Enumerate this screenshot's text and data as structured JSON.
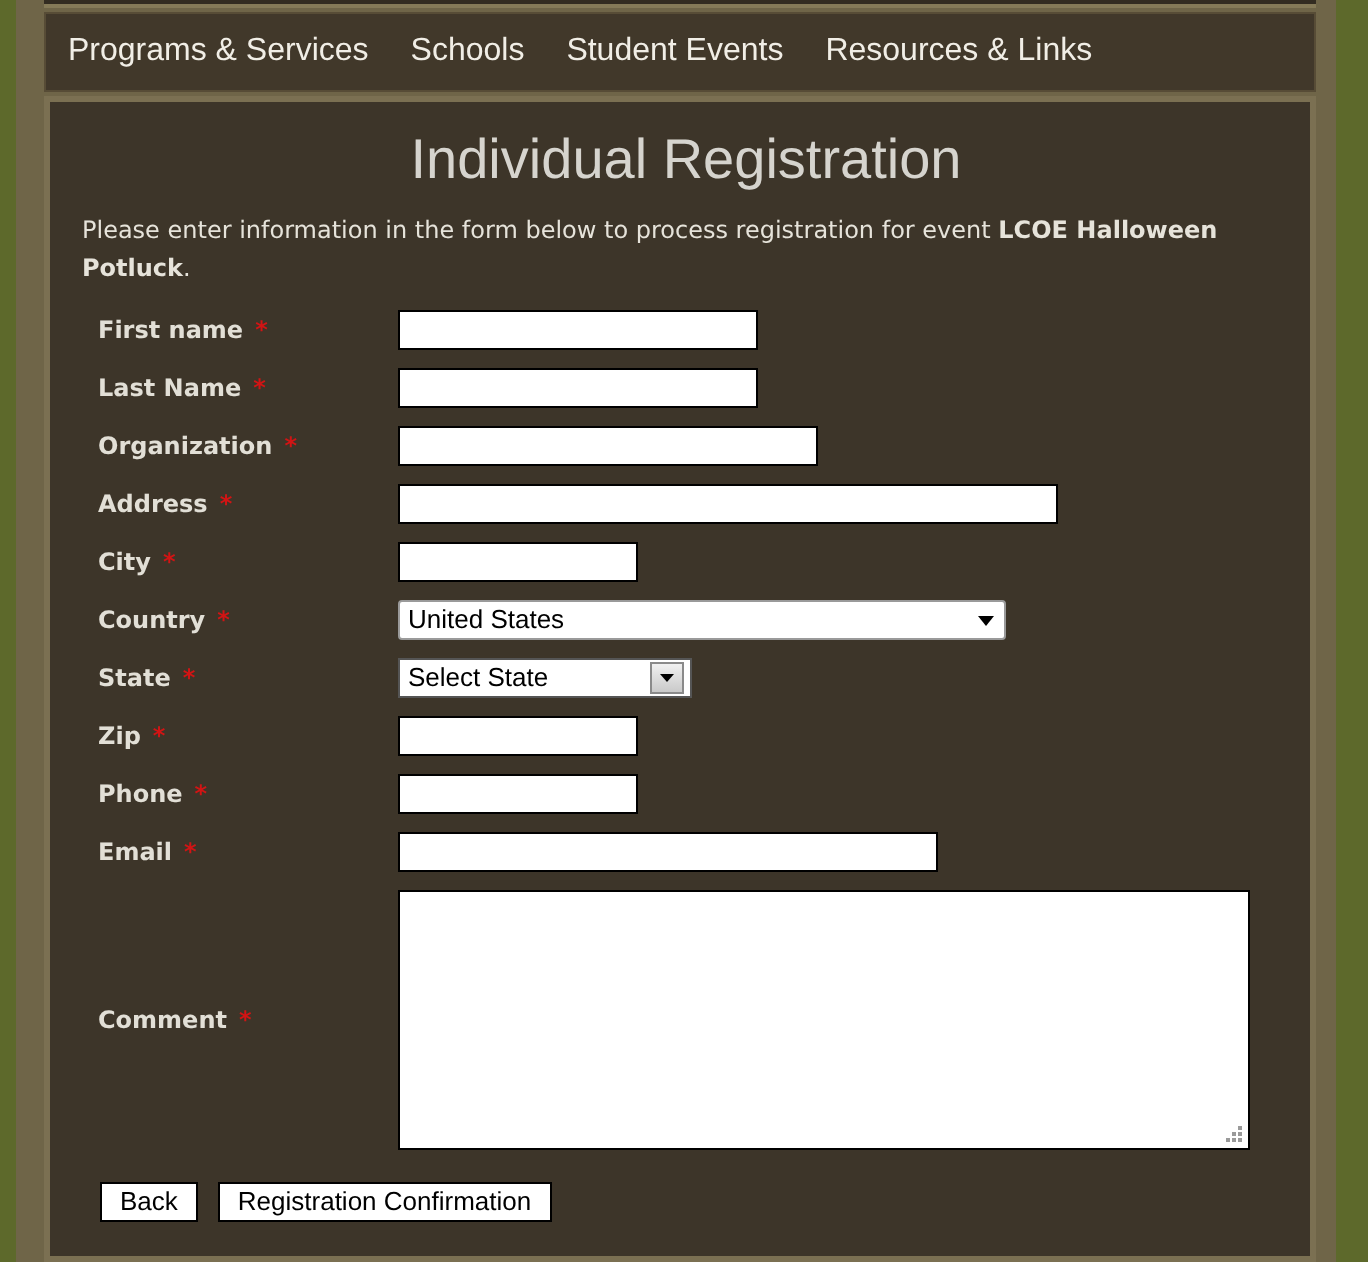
{
  "nav_items": [
    "Programs & Services",
    "Schools",
    "Student Events",
    "Resources & Links"
  ],
  "title": "Individual Registration",
  "intro": "Please enter information in the form below to process registration for event **LCOE Halloween Potluck**.",
  "fields": [
    {
      "label": "First name",
      "required_mark": "*",
      "kind": "text"
    },
    {
      "label": "Last Name",
      "required_mark": "*",
      "kind": "text"
    },
    {
      "label": "Organization",
      "required_mark": "*",
      "kind": "text"
    },
    {
      "label": "Address",
      "required_mark": "*",
      "kind": "text"
    },
    {
      "label": "City",
      "required_mark": "*",
      "kind": "text"
    },
    {
      "label": "Country",
      "required_mark": "*",
      "kind": "select",
      "value": "United States"
    },
    {
      "label": "State",
      "required_mark": "*",
      "kind": "select",
      "value": "Select State"
    },
    {
      "label": "Zip",
      "required_mark": "*",
      "kind": "text"
    },
    {
      "label": "Phone",
      "required_mark": "*",
      "kind": "text"
    },
    {
      "label": "Email",
      "required_mark": "*",
      "kind": "text"
    },
    {
      "label": "Comment",
      "required_mark": "*",
      "kind": "textarea"
    }
  ],
  "buttons": [
    "Back",
    "Registration Confirmation"
  ]
}
